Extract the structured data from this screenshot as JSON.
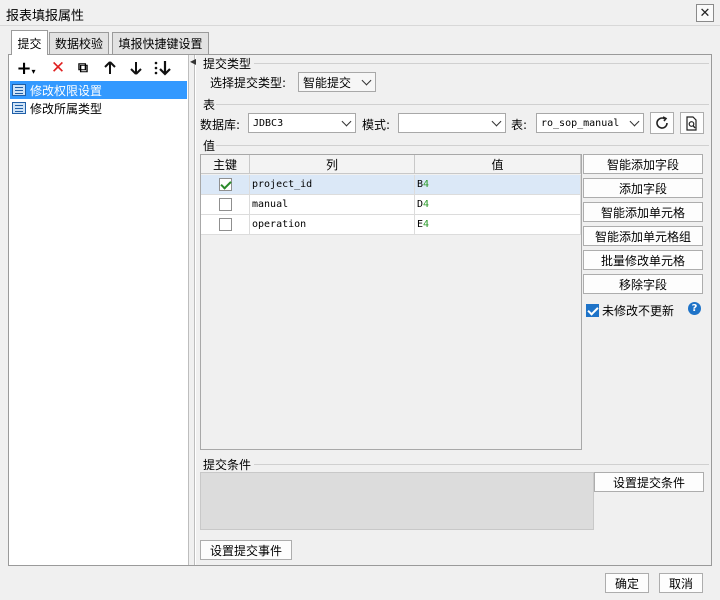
{
  "window": {
    "title": "报表填报属性",
    "close_glyph": "✕"
  },
  "tabs": [
    {
      "label": "提交"
    },
    {
      "label": "数据校验"
    },
    {
      "label": "填报快捷键设置"
    }
  ],
  "toolbar": {
    "add_glyph": "+",
    "add_dropdown_glyph": "▾",
    "delete_glyph": "✕",
    "copy_glyph": "⧉",
    "up_glyph": "🡑",
    "down_glyph": "🡓",
    "sort_glyph": "⇊"
  },
  "tree": {
    "items": [
      {
        "label": "修改权限设置",
        "selected": true
      },
      {
        "label": "修改所属类型",
        "selected": false
      }
    ]
  },
  "submit_type": {
    "section_label": "提交类型",
    "select_label": "选择提交类型:",
    "select_value": "智能提交"
  },
  "table_section": {
    "section_label": "表",
    "db_label": "数据库:",
    "db_value": "JDBC3",
    "schema_label": "模式:",
    "schema_value": "",
    "table_label": "表:",
    "table_value": "ro_sop_manual"
  },
  "values_section": {
    "section_label": "值",
    "headers": {
      "key": "主键",
      "column": "列",
      "value": "值"
    },
    "rows": [
      {
        "key": true,
        "column": "project_id",
        "value_col": "B",
        "value_row": "4"
      },
      {
        "key": false,
        "column": "manual",
        "value_col": "D",
        "value_row": "4"
      },
      {
        "key": false,
        "column": "operation",
        "value_col": "E",
        "value_row": "4"
      }
    ],
    "buttons": {
      "smart_add_field": "智能添加字段",
      "add_field": "添加字段",
      "smart_add_cell": "智能添加单元格",
      "smart_add_cell_group": "智能添加单元格组",
      "batch_modify_cell": "批量修改单元格",
      "remove_field": "移除字段"
    },
    "no_update_label": "未修改不更新",
    "help_glyph": "?"
  },
  "condition_section": {
    "section_label": "提交条件",
    "set_condition_button": "设置提交条件"
  },
  "set_event_button": "设置提交事件",
  "footer": {
    "ok": "确定",
    "cancel": "取消"
  },
  "colors": {
    "selection": "#3399ff",
    "accent": "#1e73c8",
    "check_green": "#2a8a2a"
  }
}
